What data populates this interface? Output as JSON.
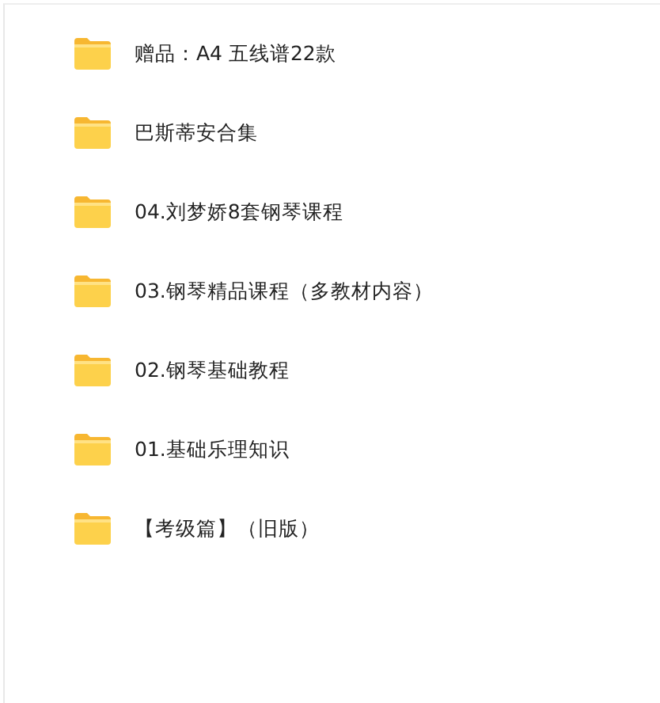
{
  "folders": [
    {
      "name": "赠品：A4 五线谱22款"
    },
    {
      "name": "巴斯蒂安合集"
    },
    {
      "name": "04.刘梦娇8套钢琴课程"
    },
    {
      "name": "03.钢琴精品课程（多教材内容）"
    },
    {
      "name": "02.钢琴基础教程"
    },
    {
      "name": "01.基础乐理知识"
    },
    {
      "name": "【考级篇】（旧版）"
    }
  ]
}
